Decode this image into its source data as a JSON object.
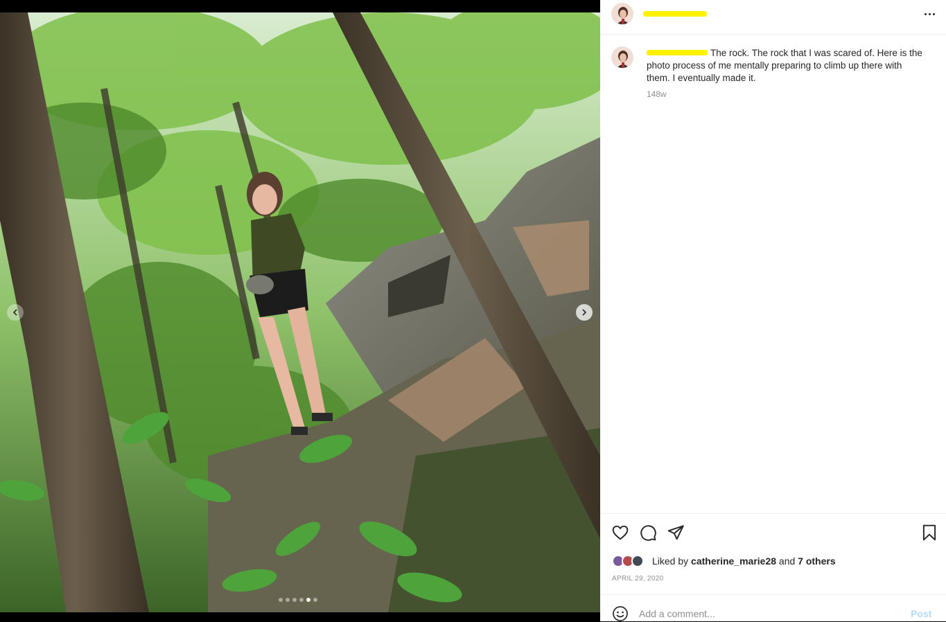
{
  "post": {
    "caption_text": "The rock. The rock that I was scared of. Here is the photo process of me mentally preparing to climb up there with them. I eventually made it.",
    "caption_age": "148w",
    "date": "APRIL 29, 2020"
  },
  "author": {
    "username_redacted_color": "#fff200"
  },
  "likes": {
    "prefix": "Liked by",
    "first_liker": "catherine_marie28",
    "joiner": "and",
    "others": "7 others"
  },
  "comment_box": {
    "placeholder": "Add a comment...",
    "post_label": "Post"
  },
  "carousel": {
    "slide_count": 6,
    "active_slide": 5
  },
  "icons": {
    "like": "heart-icon",
    "comment": "comment-bubble-icon",
    "share": "paper-plane-icon",
    "save": "bookmark-icon",
    "emoji": "smiley-icon",
    "more": "more-dots-icon",
    "prev": "chevron-left-icon",
    "next": "chevron-right-icon"
  },
  "colors": {
    "link_disabled": "#b3dbff",
    "muted": "#8e8e8e",
    "text": "#262626"
  }
}
